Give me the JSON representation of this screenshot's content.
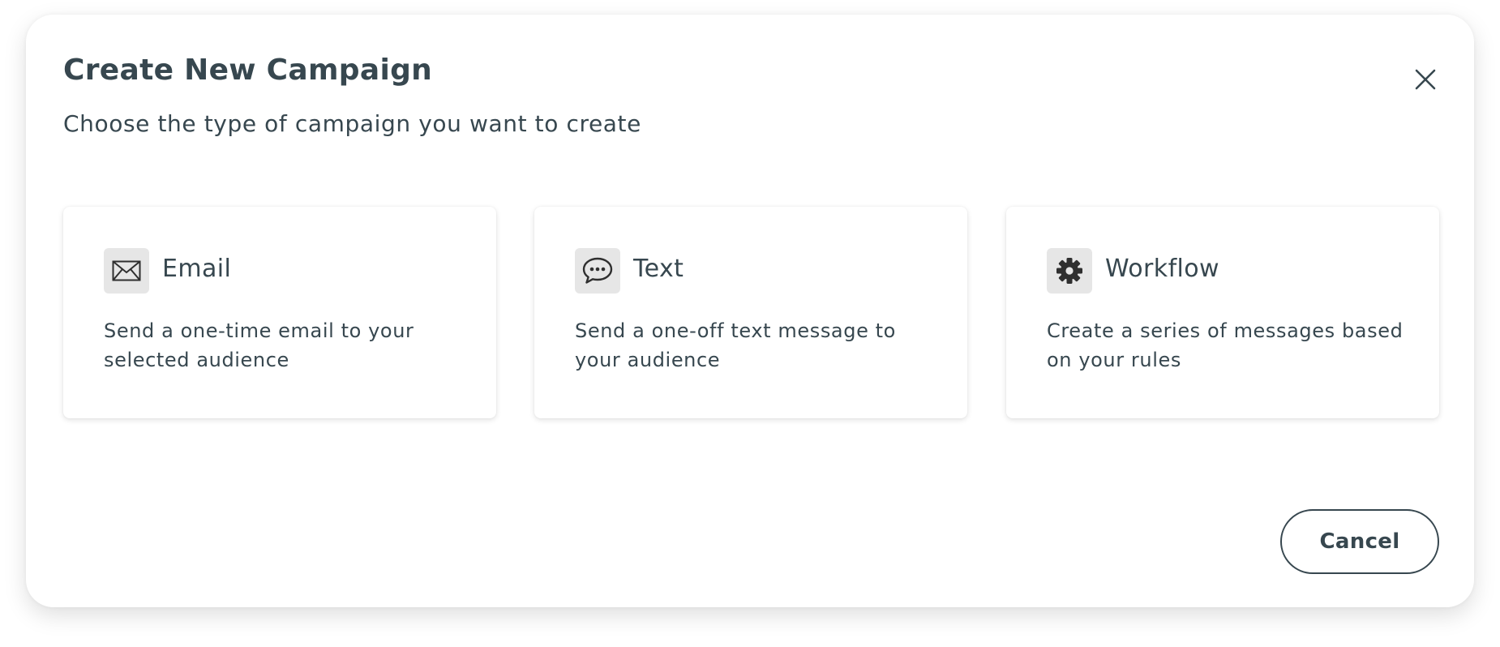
{
  "dialog": {
    "title": "Create New Campaign",
    "subtitle": "Choose the type of campaign you want to create",
    "close_icon": "close-icon"
  },
  "options": [
    {
      "icon": "envelope-icon",
      "title": "Email",
      "description": "Send a one-time email to your selected audience"
    },
    {
      "icon": "chat-bubble-icon",
      "title": "Text",
      "description": "Send a one-off text message to your audience"
    },
    {
      "icon": "gear-icon",
      "title": "Workflow",
      "description": "Create a series of messages based on your rules"
    }
  ],
  "footer": {
    "cancel_label": "Cancel"
  },
  "colors": {
    "text": "#37474f",
    "icon_tile": "#e6e6e6",
    "surface": "#ffffff"
  }
}
